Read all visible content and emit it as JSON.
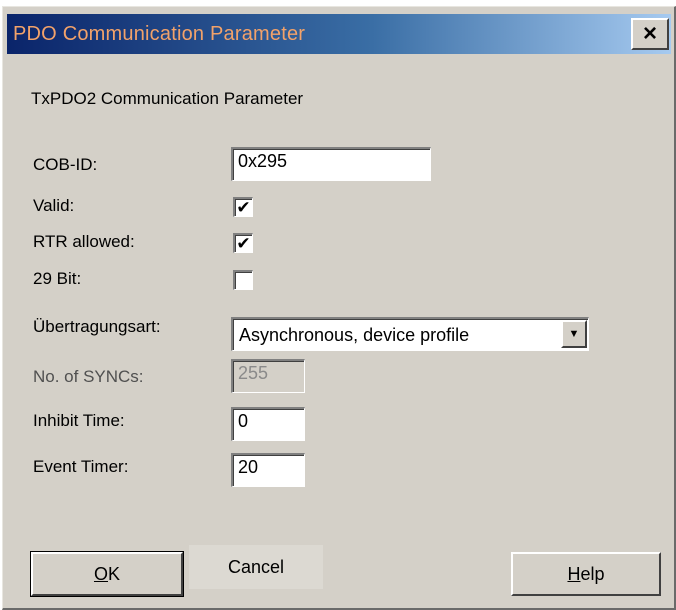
{
  "window": {
    "title": "PDO Communication Parameter",
    "close_glyph": "×"
  },
  "subtitle": "TxPDO2 Communication Parameter",
  "form": {
    "cob_id": {
      "label": "COB-ID:",
      "value": "0x295"
    },
    "valid": {
      "label": "Valid:",
      "checked": true
    },
    "rtr_allowed": {
      "label": "RTR allowed:",
      "checked": true
    },
    "bit29": {
      "label": "29 Bit:",
      "checked": false
    },
    "transmission_type": {
      "label": "Übertragungsart:",
      "value": "Asynchronous, device profile"
    },
    "no_of_syncs": {
      "label": "No. of SYNCs:",
      "value": "255",
      "disabled": true
    },
    "inhibit_time": {
      "label": "Inhibit Time:",
      "value": "0"
    },
    "event_timer": {
      "label": "Event Timer:",
      "value": "20"
    }
  },
  "buttons": {
    "ok": {
      "mnemonic": "O",
      "rest": "K"
    },
    "cancel": {
      "label": "Cancel"
    },
    "help": {
      "mnemonic": "H",
      "rest": "elp"
    }
  },
  "icons": {
    "dropdown": "chevron-down-icon",
    "close": "close-icon",
    "check": "checkmark-icon"
  },
  "colors": {
    "dialog_bg": "#d4d0c8",
    "title_text": "#f2a26a",
    "title_gradient_start": "#0a246a"
  }
}
